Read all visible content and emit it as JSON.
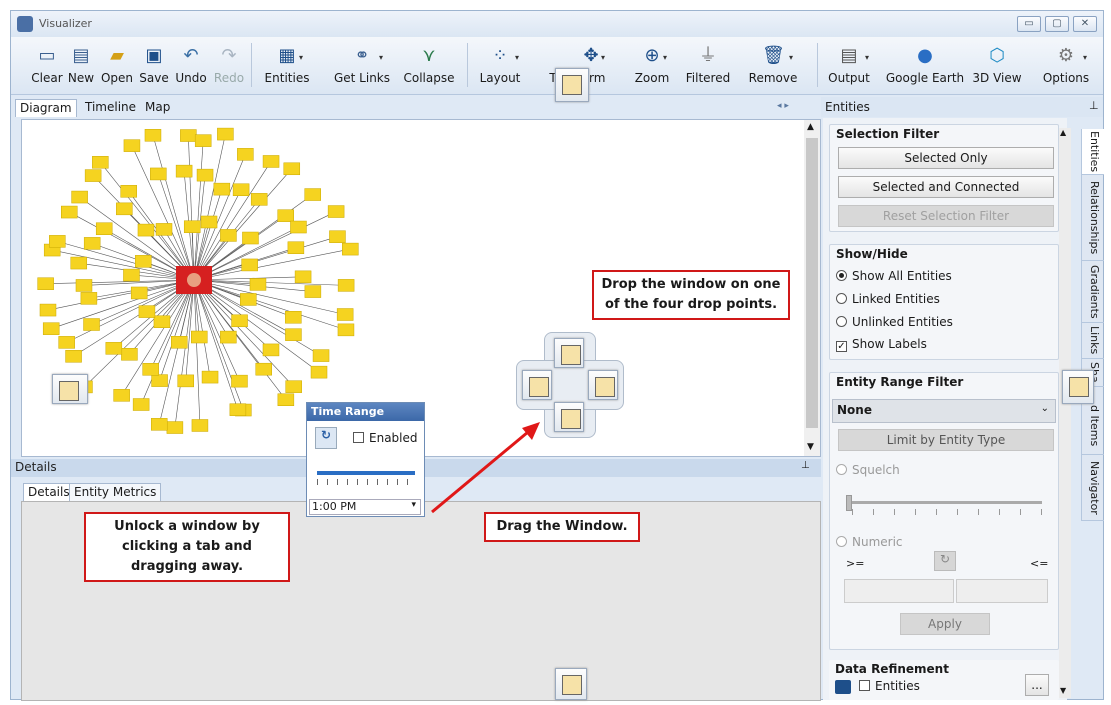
{
  "window": {
    "title": "Visualizer"
  },
  "toolbar": {
    "items": [
      {
        "label": "Clear",
        "icon": "clear-icon"
      },
      {
        "label": "New",
        "icon": "new-icon"
      },
      {
        "label": "Open",
        "icon": "open-folder-icon"
      },
      {
        "label": "Save",
        "icon": "save-disk-icon"
      },
      {
        "label": "Undo",
        "icon": "undo-icon"
      },
      {
        "label": "Redo",
        "icon": "redo-icon",
        "disabled": true
      },
      {
        "label": "Entities",
        "icon": "entities-card-icon"
      },
      {
        "label": "Get Links",
        "icon": "links-chain-icon"
      },
      {
        "label": "Collapse",
        "icon": "collapse-icon"
      },
      {
        "label": "Layout",
        "icon": "layout-icon"
      },
      {
        "label": "T",
        "icon": "transform-icon"
      },
      {
        "label": "rm",
        "icon": "transform-icon"
      },
      {
        "label": "Zoom",
        "icon": "zoom-magnifier-icon"
      },
      {
        "label": "Filtered",
        "icon": "filter-funnel-icon"
      },
      {
        "label": "Remove",
        "icon": "trash-icon"
      },
      {
        "label": "Output",
        "icon": "output-document-icon"
      },
      {
        "label": "Google Earth",
        "icon": "globe-icon"
      },
      {
        "label": "3D View",
        "icon": "cube-icon"
      },
      {
        "label": "Options",
        "icon": "gear-icon"
      }
    ]
  },
  "doc_tabs": [
    "Diagram",
    "Timeline",
    "Map"
  ],
  "details": {
    "header": "Details",
    "tabs": [
      "Details",
      "Entity Metrics"
    ]
  },
  "right_panel": {
    "header": "Entities",
    "selection_filter": {
      "title": "Selection Filter",
      "selected_only": "Selected Only",
      "selected_connected": "Selected and Connected",
      "reset": "Reset Selection Filter"
    },
    "show_hide": {
      "title": "Show/Hide",
      "options": [
        "Show All Entities",
        "Linked Entities",
        "Unlinked Entities"
      ],
      "show_labels": "Show Labels"
    },
    "range_filter": {
      "title": "Entity Range Filter",
      "dropdown_value": "None",
      "limit_button": "Limit by Entity Type",
      "squelch": "Squelch",
      "numeric": "Numeric",
      "ge": ">=",
      "le": "<=",
      "apply": "Apply"
    },
    "data_refinement": {
      "title": "Data Refinement",
      "entities": "Entities",
      "more": "..."
    },
    "vertical_tabs": [
      "Entities",
      "Relationships",
      "Gradients",
      "Links",
      "Sha",
      "d Items",
      "Navigator"
    ]
  },
  "time_range": {
    "title": "Time Range",
    "enabled": "Enabled",
    "time_value": "1:00 PM"
  },
  "annotations": {
    "drop": "Drop the window on one of the four drop points.",
    "unlock": "Unlock a window by clicking a tab and dragging away.",
    "drag": "Drag the Window."
  }
}
